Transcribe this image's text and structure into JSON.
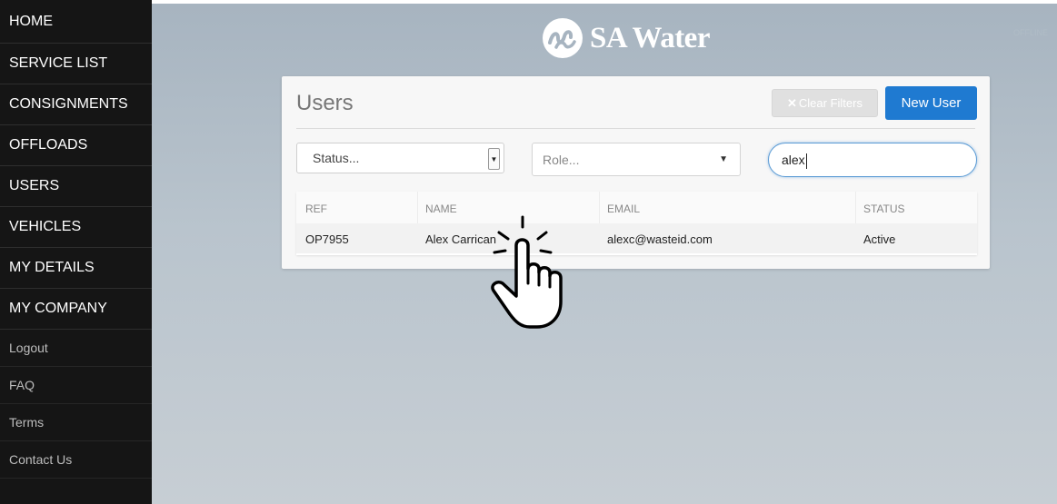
{
  "sidebar": {
    "items": [
      {
        "label": "HOME"
      },
      {
        "label": "SERVICE LIST"
      },
      {
        "label": "CONSIGNMENTS"
      },
      {
        "label": "OFFLOADS"
      },
      {
        "label": "USERS"
      },
      {
        "label": "VEHICLES"
      },
      {
        "label": "MY DETAILS"
      },
      {
        "label": "MY COMPANY"
      }
    ],
    "sub_items": [
      {
        "label": "Logout"
      },
      {
        "label": "FAQ"
      },
      {
        "label": "Terms"
      },
      {
        "label": "Contact Us"
      }
    ]
  },
  "header": {
    "logo_text": "SA Water",
    "top_right_text": "OFFLINE"
  },
  "panel": {
    "title": "Users",
    "clear_filters_label": "Clear Filters",
    "new_user_label": "New User",
    "filters": {
      "status_value": "Status...",
      "role_value": "Role...",
      "search_value": "alex"
    },
    "table": {
      "columns": [
        "REF",
        "NAME",
        "EMAIL",
        "STATUS"
      ],
      "rows": [
        {
          "ref": "OP7955",
          "name": "Alex Carrican",
          "email": "alexc@wasteid.com",
          "status": "Active"
        }
      ]
    }
  },
  "colors": {
    "sidebar_bg": "#151515",
    "primary_button": "#1f7ad1",
    "background_gradient_top": "#a7b4c0"
  },
  "icons": {
    "logo_icon": "sa-water-logo-icon",
    "cursor": "pointing-hand-cursor-icon"
  }
}
